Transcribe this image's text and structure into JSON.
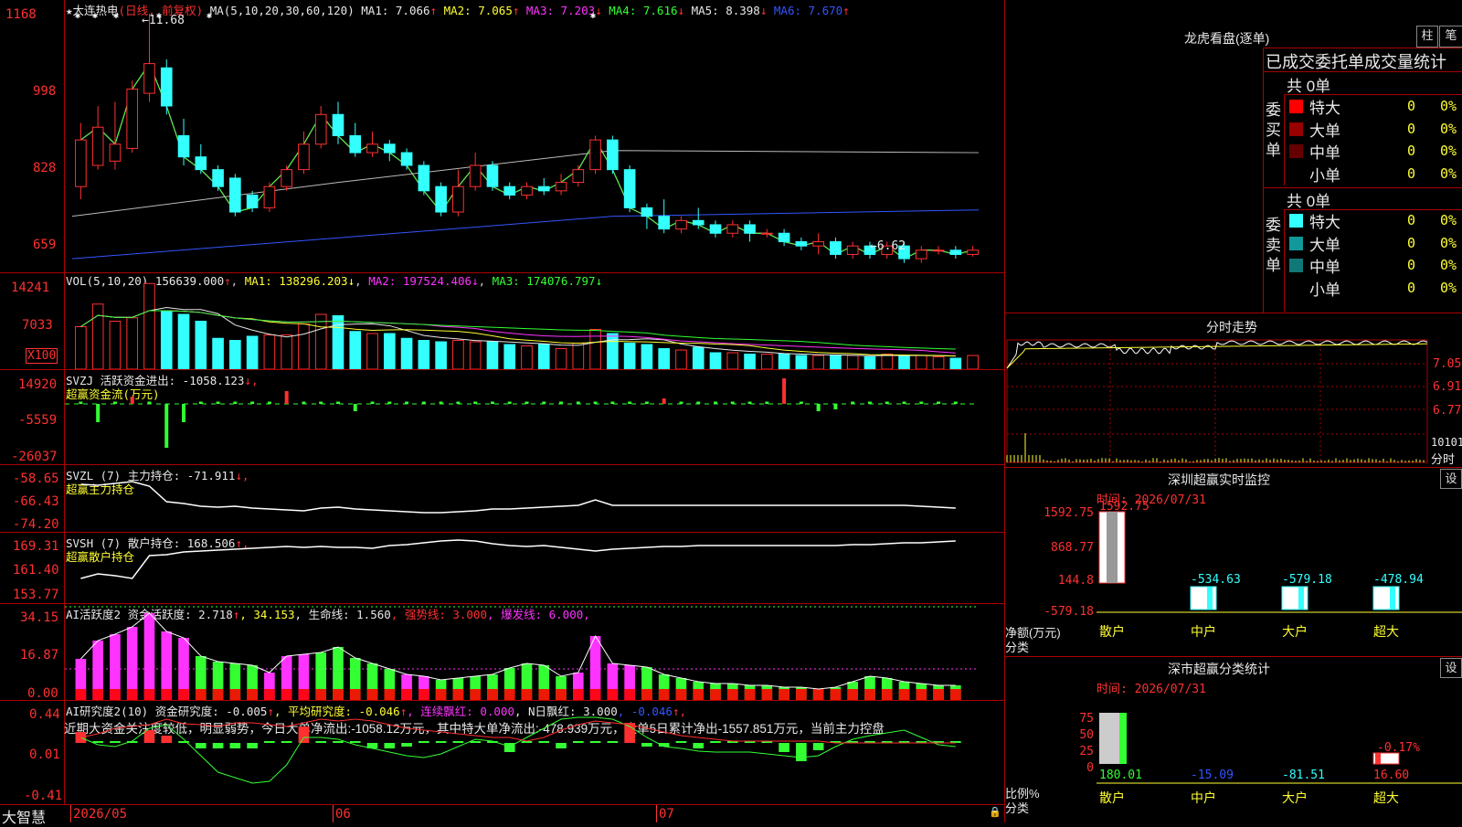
{
  "stock": {
    "star": "★",
    "name": "大连热电",
    "period": "(日线, 前复权)"
  },
  "ma_header": {
    "label": "MA(5,10,20,30,60,120)",
    "items": [
      {
        "name": "MA1:",
        "value": "7.066",
        "arrow": "↑",
        "color": "#e8e8e8"
      },
      {
        "name": "MA2:",
        "value": "7.065",
        "arrow": "↑",
        "color": "#ffff33"
      },
      {
        "name": "MA3:",
        "value": "7.203",
        "arrow": "↓",
        "color": "#ff33ff"
      },
      {
        "name": "MA4:",
        "value": "7.616",
        "arrow": "↓",
        "color": "#33ff33"
      },
      {
        "name": "MA5:",
        "value": "8.398",
        "arrow": "↓",
        "color": "#e8e8e8"
      },
      {
        "name": "MA6:",
        "value": "7.670",
        "arrow": "↑",
        "color": "#3355ff"
      }
    ]
  },
  "price_axis": [
    "1168",
    "998",
    "828",
    "659"
  ],
  "price_annotations": {
    "high": "11.68",
    "low": "6.62"
  },
  "vol_header": {
    "label": "VOL(5,10,20)",
    "value": "156639.000",
    "ma1": "MA1: 138296.203",
    "ma2": "MA2: 197524.406",
    "ma3": "MA3: 174076.797"
  },
  "vol_axis": [
    "14241",
    "7033"
  ],
  "vol_unit": "X100",
  "svzj": {
    "header": "SVZJ  活跃资金进出: -1058.123",
    "arrow": "↓,",
    "subtitle": "超赢资金流(万元)",
    "axis": [
      "14920",
      "-5559",
      "-26037"
    ]
  },
  "svzl": {
    "header": "SVZL  (7) 主力持仓: -71.911",
    "arrow": "↓,",
    "subtitle": "超赢主力持仓",
    "axis": [
      "-58.65",
      "-66.43",
      "-74.20"
    ]
  },
  "svsh": {
    "header": "SVSH  (7) 散户持仓: 168.506",
    "arrow": "↑,",
    "subtitle": "超赢散户持仓",
    "axis": [
      "169.31",
      "161.40",
      "153.77"
    ]
  },
  "ai1": {
    "p1": "AI活跃度2 资金活跃度: 2.718",
    "p1a": "↑",
    "p2": ", 34.153",
    "p3": ", 生命线: 1.560",
    "p4": ", 强势线: 3.000",
    "p5": ", 爆发线: 6.000,",
    "axis": [
      "34.15",
      "16.87",
      "0.00"
    ]
  },
  "ai2": {
    "p1": "AI研究度2(10) 资金研究度: -0.005",
    "p1a": "↑",
    "p2": ", 平均研究度: -0.046",
    "p2a": "↑",
    "p3": ", 连续飘红: 0.000",
    "p4": ", N日飘红: 3.000",
    "p5": ", -0.046",
    "p5a": "↑,",
    "axis": [
      "0.44",
      "0.01",
      "-0.41"
    ],
    "note": "近期大资金关注度较低，明显弱势，今日大单净流出:-1058.12万元，其中特大单净流出:-478.939万元，大单5日累计净出-1557.851万元，当前主力控盘"
  },
  "footer": {
    "logo": "大智慧",
    "dates": [
      "2026/05",
      "06",
      "07"
    ]
  },
  "dragon": {
    "title": "龙虎看盘(逐单)",
    "btn1": "柱",
    "btn2": "笔",
    "header": "已成交委托单成交量统计",
    "buy": {
      "label": "委买单",
      "total": "共 0单",
      "rows": [
        {
          "name": "特大",
          "v": "0",
          "p": "0%",
          "color": "#ff0000"
        },
        {
          "name": "大单",
          "v": "0",
          "p": "0%",
          "color": "#990000"
        },
        {
          "name": "中单",
          "v": "0",
          "p": "0%",
          "color": "#660000"
        },
        {
          "name": "小单",
          "v": "0",
          "p": "0%",
          "color": "#000"
        }
      ]
    },
    "sell": {
      "label": "委卖单",
      "total": "共 0单",
      "rows": [
        {
          "name": "特大",
          "v": "0",
          "p": "0%",
          "color": "#33ffff"
        },
        {
          "name": "大单",
          "v": "0",
          "p": "0%",
          "color": "#119999"
        },
        {
          "name": "中单",
          "v": "0",
          "p": "0%",
          "color": "#117777"
        },
        {
          "name": "小单",
          "v": "0",
          "p": "0%",
          "color": "#000"
        }
      ]
    }
  },
  "intraday": {
    "title": "分时走势",
    "axis": [
      "7.05",
      "6.91",
      "6.77"
    ],
    "vol_label": "10101",
    "time_label": "分时"
  },
  "sz_monitor": {
    "title": "深圳超赢实时监控",
    "btn": "设",
    "time": "时间: 2026/07/31",
    "axis": [
      "1592.75",
      "868.77",
      "144.8",
      "-579.18"
    ],
    "ylabel": "净额(万元)",
    "xlabel": "分类",
    "bars": [
      {
        "cat": "散户",
        "v": 1592.75,
        "label": "1592.75"
      },
      {
        "cat": "中户",
        "v": -534.63,
        "label": "-534.63"
      },
      {
        "cat": "大户",
        "v": -579.18,
        "label": "-579.18"
      },
      {
        "cat": "超大",
        "v": -478.94,
        "label": "-478.94"
      }
    ]
  },
  "sz_class": {
    "title": "深市超赢分类统计",
    "btn": "设",
    "time": "时间: 2026/07/31",
    "axis": [
      "75",
      "50",
      "25",
      "0"
    ],
    "ylabel": "比例%",
    "xlabel": "分类",
    "bars": [
      {
        "cat": "散户",
        "v": 180.01,
        "label": "180.01",
        "color": "#33ff33"
      },
      {
        "cat": "中户",
        "v": -15.09,
        "label": "-15.09",
        "color": "#3355ff"
      },
      {
        "cat": "大户",
        "v": -81.51,
        "label": "-81.51",
        "color": "#33ffff"
      },
      {
        "cat": "超大",
        "v": 16.6,
        "label": "16.60",
        "color": "#ff3030"
      }
    ],
    "extra_label": "-0.17%"
  },
  "chart_data": {
    "type": "candlestick",
    "title": "大连热电 (日线, 前复权)",
    "x_dates": [
      "2026/05",
      "06",
      "07"
    ],
    "candles": [
      {
        "o": 7.6,
        "c": 8.7,
        "h": 9.1,
        "l": 7.3
      },
      {
        "o": 8.1,
        "c": 9.0,
        "h": 9.5,
        "l": 8.0
      },
      {
        "o": 8.2,
        "c": 8.6,
        "h": 9.6,
        "l": 8.0
      },
      {
        "o": 8.5,
        "c": 9.9,
        "h": 10.1,
        "l": 8.4
      },
      {
        "o": 9.8,
        "c": 10.5,
        "h": 11.68,
        "l": 9.6
      },
      {
        "o": 10.4,
        "c": 9.5,
        "h": 10.6,
        "l": 9.3
      },
      {
        "o": 8.8,
        "c": 8.3,
        "h": 9.2,
        "l": 8.1
      },
      {
        "o": 8.3,
        "c": 8.0,
        "h": 8.6,
        "l": 7.9
      },
      {
        "o": 8.0,
        "c": 7.6,
        "h": 8.1,
        "l": 7.5
      },
      {
        "o": 7.8,
        "c": 7.0,
        "h": 7.9,
        "l": 6.9
      },
      {
        "o": 7.4,
        "c": 7.1,
        "h": 7.5,
        "l": 7.0
      },
      {
        "o": 7.1,
        "c": 7.6,
        "h": 7.7,
        "l": 7.0
      },
      {
        "o": 7.6,
        "c": 8.0,
        "h": 8.1,
        "l": 7.5
      },
      {
        "o": 8.0,
        "c": 8.6,
        "h": 8.9,
        "l": 7.9
      },
      {
        "o": 8.6,
        "c": 9.3,
        "h": 9.5,
        "l": 8.5
      },
      {
        "o": 9.3,
        "c": 8.8,
        "h": 9.6,
        "l": 8.6
      },
      {
        "o": 8.8,
        "c": 8.4,
        "h": 9.1,
        "l": 8.3
      },
      {
        "o": 8.4,
        "c": 8.6,
        "h": 8.9,
        "l": 8.3
      },
      {
        "o": 8.6,
        "c": 8.4,
        "h": 8.7,
        "l": 8.2
      },
      {
        "o": 8.4,
        "c": 8.1,
        "h": 8.5,
        "l": 8.0
      },
      {
        "o": 8.1,
        "c": 7.5,
        "h": 8.2,
        "l": 7.4
      },
      {
        "o": 7.6,
        "c": 7.0,
        "h": 7.7,
        "l": 6.9
      },
      {
        "o": 7.0,
        "c": 7.6,
        "h": 8.0,
        "l": 6.9
      },
      {
        "o": 7.6,
        "c": 8.1,
        "h": 8.4,
        "l": 7.5
      },
      {
        "o": 8.1,
        "c": 7.6,
        "h": 8.2,
        "l": 7.5
      },
      {
        "o": 7.6,
        "c": 7.4,
        "h": 7.7,
        "l": 7.3
      },
      {
        "o": 7.4,
        "c": 7.6,
        "h": 7.7,
        "l": 7.3
      },
      {
        "o": 7.6,
        "c": 7.5,
        "h": 7.8,
        "l": 7.4
      },
      {
        "o": 7.5,
        "c": 7.7,
        "h": 7.9,
        "l": 7.4
      },
      {
        "o": 7.7,
        "c": 8.0,
        "h": 8.1,
        "l": 7.6
      },
      {
        "o": 8.0,
        "c": 8.7,
        "h": 8.8,
        "l": 7.9
      },
      {
        "o": 8.7,
        "c": 8.0,
        "h": 8.8,
        "l": 7.9
      },
      {
        "o": 8.0,
        "c": 7.1,
        "h": 8.1,
        "l": 7.0
      },
      {
        "o": 7.1,
        "c": 6.9,
        "h": 7.2,
        "l": 6.6
      },
      {
        "o": 6.9,
        "c": 6.6,
        "h": 7.3,
        "l": 6.5
      },
      {
        "o": 6.6,
        "c": 6.8,
        "h": 6.9,
        "l": 6.5
      },
      {
        "o": 6.8,
        "c": 6.7,
        "h": 7.1,
        "l": 6.6
      },
      {
        "o": 6.7,
        "c": 6.5,
        "h": 6.8,
        "l": 6.4
      },
      {
        "o": 6.5,
        "c": 6.7,
        "h": 6.8,
        "l": 6.4
      },
      {
        "o": 6.7,
        "c": 6.5,
        "h": 6.8,
        "l": 6.3
      },
      {
        "o": 6.5,
        "c": 6.5,
        "h": 6.6,
        "l": 6.4
      },
      {
        "o": 6.5,
        "c": 6.3,
        "h": 6.6,
        "l": 6.2
      },
      {
        "o": 6.3,
        "c": 6.2,
        "h": 6.4,
        "l": 6.1
      },
      {
        "o": 6.2,
        "c": 6.3,
        "h": 6.5,
        "l": 6.0
      },
      {
        "o": 6.3,
        "c": 6.0,
        "h": 6.4,
        "l": 5.9
      },
      {
        "o": 6.0,
        "c": 6.2,
        "h": 6.3,
        "l": 5.9
      },
      {
        "o": 6.2,
        "c": 6.0,
        "h": 6.3,
        "l": 5.9
      },
      {
        "o": 6.0,
        "c": 6.2,
        "h": 6.3,
        "l": 5.9
      },
      {
        "o": 6.2,
        "c": 5.9,
        "h": 6.3,
        "l": 5.8
      },
      {
        "o": 5.9,
        "c": 6.1,
        "h": 6.2,
        "l": 5.8
      },
      {
        "o": 6.1,
        "c": 6.1,
        "h": 6.2,
        "l": 6.0
      },
      {
        "o": 6.1,
        "c": 6.0,
        "h": 6.2,
        "l": 5.9
      },
      {
        "o": 6.0,
        "c": 6.1,
        "h": 6.2,
        "l": 5.95
      }
    ]
  }
}
